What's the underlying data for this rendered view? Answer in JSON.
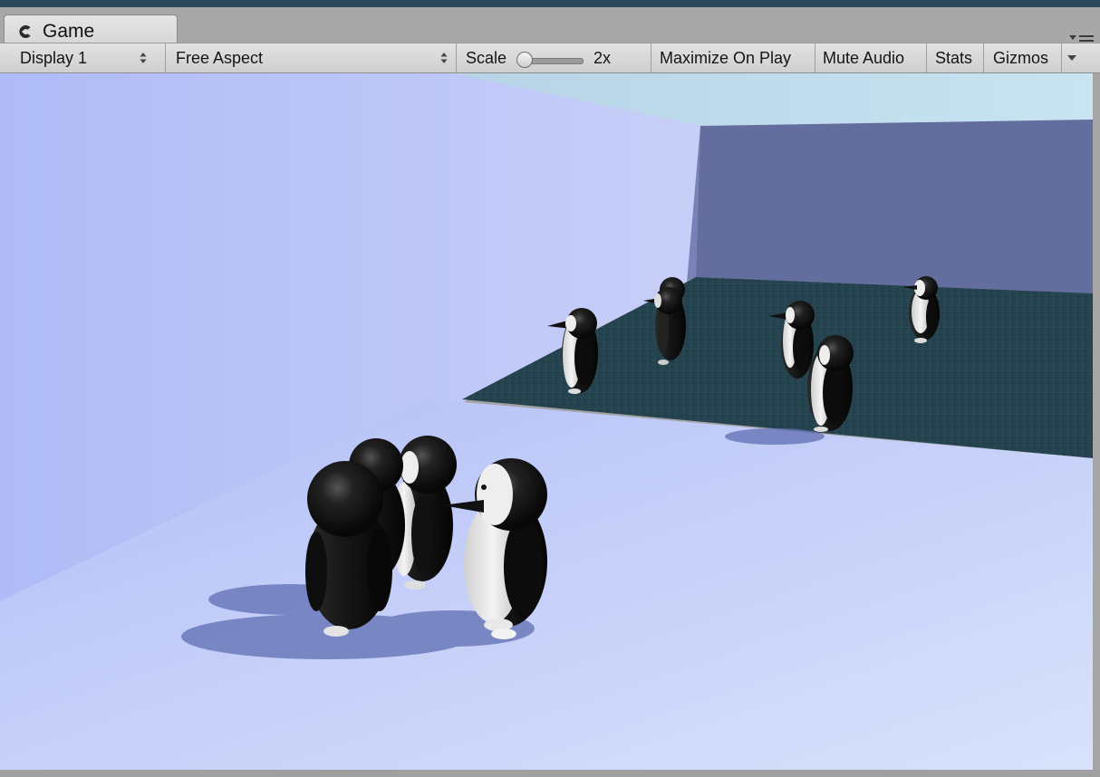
{
  "window": {
    "tab_title": "Game",
    "tab_icon": "game-controller-icon",
    "panel_menu_icon": "panel-menu-icon"
  },
  "toolbar": {
    "display": "Display 1",
    "aspect": "Free Aspect",
    "scale_label": "Scale",
    "scale_value": "2x",
    "scale_level": 0.0,
    "maximize_on_play": "Maximize On Play",
    "mute_audio": "Mute Audio",
    "stats": "Stats",
    "gizmos": "Gizmos",
    "gizmos_dropdown_icon": "dropdown-arrow-icon"
  },
  "scene": {
    "description_objects": [
      {
        "name": "penguin",
        "count": 11
      }
    ],
    "colors": {
      "sky": "#b8d8ea",
      "wall_left": "#aab8f4",
      "wall_back": "#646fa0",
      "floor": "#c4d0f8",
      "water": "#234350",
      "penguin_body": "#141414",
      "penguin_belly": "#eeeeee"
    }
  }
}
